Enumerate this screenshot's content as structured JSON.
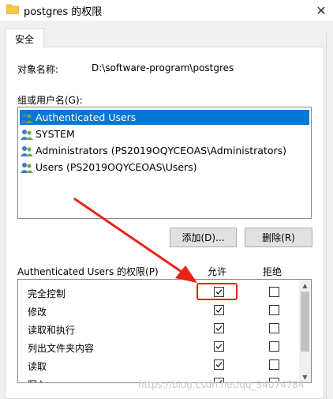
{
  "window": {
    "title": "postgres 的权限",
    "close_glyph": "✕",
    "folder_color": "#f2c94c"
  },
  "tabs": [
    {
      "label": "安全"
    }
  ],
  "object": {
    "label": "对象名称:",
    "value": "D:\\software-program\\postgres"
  },
  "groups": {
    "label": "组或用户名(G):",
    "items": [
      {
        "label": "Authenticated Users",
        "icon": "users-icon",
        "selected": true
      },
      {
        "label": "SYSTEM",
        "icon": "users-icon",
        "selected": false
      },
      {
        "label": "Administrators (PS2019OQYCEOAS\\Administrators)",
        "icon": "users-icon",
        "selected": false
      },
      {
        "label": "Users (PS2019OQYCEOAS\\Users)",
        "icon": "users-icon",
        "selected": false
      }
    ]
  },
  "buttons": {
    "add_label": "添加(D)...",
    "remove_label": "删除(R)"
  },
  "permissions": {
    "label": "Authenticated Users 的权限(P)",
    "allow_header": "允许",
    "deny_header": "拒绝",
    "rows": [
      {
        "name": "完全控制",
        "allow": true,
        "deny": false
      },
      {
        "name": "修改",
        "allow": true,
        "deny": false
      },
      {
        "name": "读取和执行",
        "allow": true,
        "deny": false
      },
      {
        "name": "列出文件夹内容",
        "allow": true,
        "deny": false
      },
      {
        "name": "读取",
        "allow": true,
        "deny": false
      },
      {
        "name": "写入",
        "allow": true,
        "deny": false
      }
    ]
  },
  "annotation": {
    "color": "#e8241a"
  },
  "watermark": "https://blog.csdn.net/qq_34074784",
  "colors": {
    "selection": "#0078d7",
    "button_bg": "#e1e1e1"
  }
}
